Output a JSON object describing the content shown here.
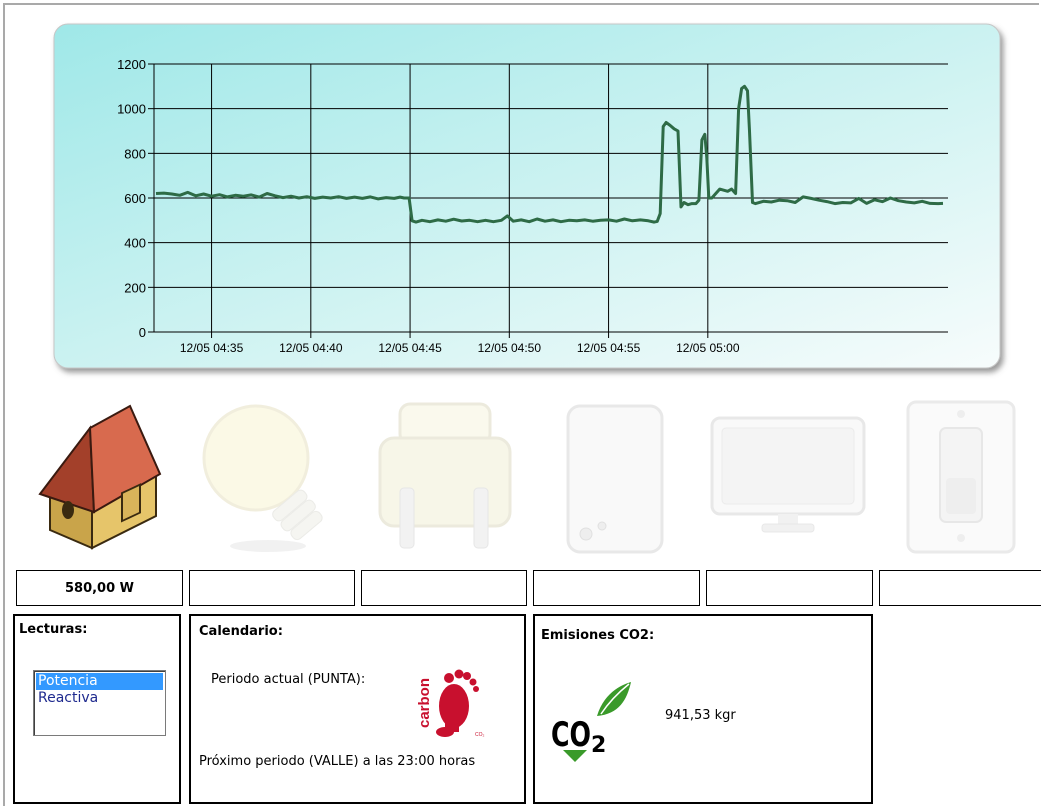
{
  "chart_data": {
    "type": "line",
    "x_ticks": [
      "12/05 04:35",
      "12/05 04:40",
      "12/05 04:45",
      "12/05 04:50",
      "12/05 04:55",
      "12/05 05:00"
    ],
    "y_ticks": [
      "0",
      "200",
      "400",
      "600",
      "800",
      "1000",
      "1200"
    ],
    "ylim": [
      0,
      1200
    ],
    "xlim_minutes_after_0430": [
      2.1,
      30.3
    ],
    "grid": true,
    "series": [
      {
        "color": "#2e6b46",
        "points": [
          [
            2.2,
            620
          ],
          [
            2.6,
            622
          ],
          [
            3.0,
            618
          ],
          [
            3.4,
            612
          ],
          [
            3.8,
            625
          ],
          [
            4.2,
            610
          ],
          [
            4.6,
            618
          ],
          [
            5.0,
            608
          ],
          [
            5.4,
            615
          ],
          [
            5.8,
            605
          ],
          [
            6.2,
            612
          ],
          [
            6.6,
            608
          ],
          [
            7.0,
            614
          ],
          [
            7.4,
            604
          ],
          [
            7.8,
            620
          ],
          [
            8.2,
            610
          ],
          [
            8.6,
            602
          ],
          [
            9.0,
            608
          ],
          [
            9.4,
            600
          ],
          [
            9.8,
            606
          ],
          [
            10.2,
            598
          ],
          [
            10.6,
            604
          ],
          [
            11.0,
            600
          ],
          [
            11.4,
            606
          ],
          [
            11.8,
            598
          ],
          [
            12.2,
            604
          ],
          [
            12.6,
            598
          ],
          [
            13.0,
            605
          ],
          [
            13.4,
            596
          ],
          [
            13.8,
            602
          ],
          [
            14.2,
            598
          ],
          [
            14.5,
            604
          ],
          [
            14.7,
            600
          ],
          [
            14.95,
            600
          ],
          [
            15.1,
            498
          ],
          [
            15.3,
            492
          ],
          [
            15.6,
            500
          ],
          [
            16.0,
            494
          ],
          [
            16.4,
            502
          ],
          [
            16.8,
            496
          ],
          [
            17.2,
            505
          ],
          [
            17.6,
            497
          ],
          [
            18.0,
            500
          ],
          [
            18.4,
            494
          ],
          [
            18.8,
            500
          ],
          [
            19.2,
            494
          ],
          [
            19.6,
            500
          ],
          [
            19.9,
            520
          ],
          [
            20.2,
            496
          ],
          [
            20.6,
            502
          ],
          [
            21.0,
            494
          ],
          [
            21.4,
            506
          ],
          [
            21.8,
            496
          ],
          [
            22.2,
            502
          ],
          [
            22.6,
            494
          ],
          [
            23.0,
            500
          ],
          [
            23.4,
            498
          ],
          [
            23.8,
            502
          ],
          [
            24.2,
            496
          ],
          [
            24.6,
            500
          ],
          [
            25.0,
            502
          ],
          [
            25.4,
            496
          ],
          [
            25.8,
            506
          ],
          [
            26.2,
            498
          ],
          [
            26.6,
            502
          ],
          [
            27.0,
            498
          ],
          [
            27.3,
            492
          ],
          [
            27.45,
            495
          ],
          [
            27.6,
            530
          ],
          [
            27.75,
            920
          ],
          [
            27.9,
            938
          ],
          [
            28.1,
            925
          ],
          [
            28.3,
            910
          ],
          [
            28.5,
            900
          ],
          [
            28.65,
            560
          ],
          [
            28.8,
            580
          ],
          [
            29.0,
            570
          ],
          [
            29.2,
            575
          ],
          [
            29.4,
            575
          ],
          [
            29.55,
            590
          ],
          [
            29.7,
            860
          ],
          [
            29.85,
            885
          ],
          [
            29.95,
            780
          ],
          [
            30.05,
            600
          ],
          [
            30.2,
            600
          ],
          [
            30.4,
            620
          ],
          [
            30.6,
            640
          ],
          [
            30.8,
            635
          ],
          [
            31.0,
            630
          ],
          [
            31.2,
            640
          ],
          [
            31.4,
            620
          ],
          [
            31.55,
            1000
          ],
          [
            31.7,
            1090
          ],
          [
            31.85,
            1100
          ],
          [
            32.0,
            1080
          ],
          [
            32.1,
            900
          ],
          [
            32.25,
            580
          ],
          [
            32.4,
            575
          ],
          [
            32.8,
            585
          ],
          [
            33.2,
            582
          ],
          [
            33.6,
            590
          ],
          [
            34.0,
            588
          ],
          [
            34.4,
            580
          ],
          [
            34.8,
            605
          ],
          [
            35.2,
            598
          ],
          [
            35.6,
            590
          ],
          [
            36.0,
            584
          ],
          [
            36.4,
            575
          ],
          [
            36.8,
            580
          ],
          [
            37.2,
            578
          ],
          [
            37.6,
            598
          ],
          [
            38.0,
            576
          ],
          [
            38.4,
            592
          ],
          [
            38.8,
            584
          ],
          [
            39.2,
            600
          ],
          [
            39.6,
            588
          ],
          [
            40.0,
            582
          ],
          [
            40.4,
            578
          ],
          [
            40.8,
            585
          ],
          [
            41.2,
            576
          ],
          [
            41.6,
            575
          ],
          [
            41.85,
            576
          ]
        ]
      }
    ]
  },
  "devices": [
    {
      "icon": "house-icon",
      "active": true
    },
    {
      "icon": "lightbulb-icon",
      "active": false
    },
    {
      "icon": "plug-icon",
      "active": false
    },
    {
      "icon": "appliance-icon",
      "active": false
    },
    {
      "icon": "monitor-icon",
      "active": false
    },
    {
      "icon": "light-switch-icon",
      "active": false
    }
  ],
  "device_values": [
    "580,00 W",
    "",
    "",
    "",
    "",
    ""
  ],
  "readings": {
    "title": "Lecturas:",
    "options": [
      "Potencia",
      "Reactiva"
    ],
    "selected": "Potencia"
  },
  "calendar": {
    "title": "Calendario:",
    "current_period": "Periodo actual (PUNTA):",
    "next_period": "Próximo periodo (VALLE) a las 23:00 horas",
    "logo_text": "carbon"
  },
  "emissions": {
    "title": "Emisiones CO2:",
    "value": "941,53 kgr",
    "logo_text": "CO2"
  },
  "colors": {
    "chart_gradient_start": "#a8ecec",
    "chart_gradient_end": "#f4fbfb",
    "series_line": "#2e6b46",
    "list_selected": "#3399ff",
    "carbon_red": "#c8102e",
    "co2_green": "#3a9a2a"
  }
}
